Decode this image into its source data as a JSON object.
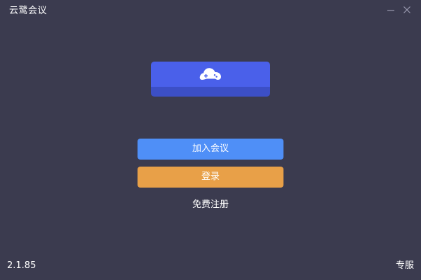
{
  "window": {
    "title": "云鹭会议"
  },
  "logo": {
    "icon": "game-controller-cloud-icon",
    "badge_color": "#4a60ea"
  },
  "actions": {
    "join_label": "加入会议",
    "login_label": "登录",
    "register_label": "免费注册",
    "join_color": "#4f8ff7",
    "login_color": "#e8a048"
  },
  "footer": {
    "version": "2.1.85",
    "edition": "专服"
  },
  "theme": {
    "background": "#3b3b4f"
  }
}
